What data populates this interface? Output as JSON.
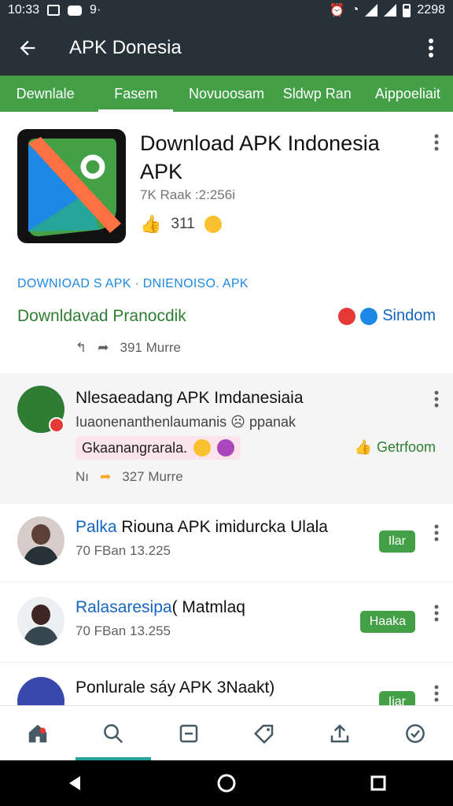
{
  "status_bar": {
    "time": "10:33",
    "battery": "2298"
  },
  "app_bar": {
    "title": "APK Donesia"
  },
  "tabs": [
    {
      "label": "Dewnlale"
    },
    {
      "label": "Fasem",
      "active": true
    },
    {
      "label": "Novuoosam"
    },
    {
      "label": "Sldwp Ran"
    },
    {
      "label": "Aippoeliait"
    }
  ],
  "header": {
    "app_name": "Download APK Indonesia APK",
    "meta": "7K Raak :2:256i",
    "likes": "311",
    "caption": "DOWNIOAD S APK · DNIENOISO. APK",
    "download_title": "Downldavad Pranocdik",
    "right_label": "Sindom",
    "share_count": "391 Murre"
  },
  "featured": {
    "title": "Nlesaeadang APK Imdanesiaia",
    "subtitle": "Iuaonenanthenlaumanis",
    "subtitle_suffix": "ppanak",
    "chip": "Gkaanangrarala.",
    "action": "Getrfoom",
    "share_prefix": "Nı",
    "share_count": "327 Murre"
  },
  "list": [
    {
      "title_highlight": "Palka",
      "title_rest": " Riouna APK imidurcka Ulala",
      "sub": "70 FBan 13.225",
      "button": "Ilar"
    },
    {
      "title_highlight": "Ralasaresipa",
      "title_rest": "( Matmlaq",
      "sub": "70 FBan 13.255",
      "button": "Haaka"
    },
    {
      "title_highlight": "",
      "title_rest": "Ponlurale sáy APK 3Naakt)",
      "sub": "",
      "button": "Iiar"
    }
  ],
  "bottom_nav": [
    {
      "icon": "home-icon"
    },
    {
      "icon": "search-icon",
      "active": true
    },
    {
      "icon": "list-icon"
    },
    {
      "icon": "tag-icon"
    },
    {
      "icon": "upload-icon"
    },
    {
      "icon": "clock-icon"
    }
  ],
  "colors": {
    "app_bar": "#263238",
    "tab_bar": "#43a047",
    "accent_blue": "#1e88e5",
    "green_text": "#2e7d32"
  }
}
